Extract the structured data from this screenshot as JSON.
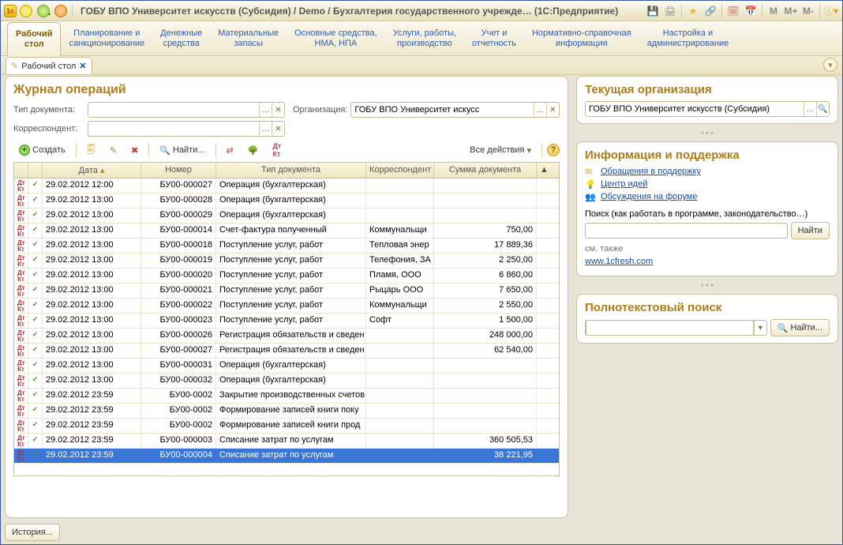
{
  "titlebar": {
    "title": "ГОБУ ВПО Университет искусств (Субсидия) / Demo / Бухгалтерия государственного учрежде… (1С:Предприятие)",
    "m": "M",
    "mplus": "M+",
    "mminus": "M-"
  },
  "nav": {
    "items": [
      {
        "l1": "Рабочий",
        "l2": "стол"
      },
      {
        "l1": "Планирование и",
        "l2": "санкционирование"
      },
      {
        "l1": "Денежные",
        "l2": "средства"
      },
      {
        "l1": "Материальные",
        "l2": "запасы"
      },
      {
        "l1": "Основные средства,",
        "l2": "НМА, НПА"
      },
      {
        "l1": "Услуги, работы,",
        "l2": "производство"
      },
      {
        "l1": "Учет и",
        "l2": "отчетность"
      },
      {
        "l1": "Нормативно-справочная",
        "l2": "информация"
      },
      {
        "l1": "Настройка и",
        "l2": "администрирование"
      }
    ]
  },
  "tabs": {
    "items": [
      {
        "label": "Рабочий стол"
      }
    ]
  },
  "journal": {
    "title": "Журнал операций",
    "doc_type_label": "Тип документа:",
    "org_label": "Организация:",
    "org_value": "ГОБУ ВПО Университет искусс",
    "korr_label": "Корреспондент:",
    "toolbar": {
      "create": "Создать",
      "find": "Найти...",
      "all_actions": "Все действия"
    },
    "columns": {
      "date": "Дата",
      "number": "Номер",
      "doc_type": "Тип документа",
      "korr": "Корреспондент",
      "sum": "Сумма документа"
    },
    "rows": [
      {
        "date": "29.02.2012 12:00",
        "num": "БУ00-000027",
        "type": "Операция (бухгалтерская)",
        "korr": "",
        "sum": ""
      },
      {
        "date": "29.02.2012 13:00",
        "num": "БУ00-000028",
        "type": "Операция (бухгалтерская)",
        "korr": "",
        "sum": ""
      },
      {
        "date": "29.02.2012 13:00",
        "num": "БУ00-000029",
        "type": "Операция (бухгалтерская)",
        "korr": "",
        "sum": ""
      },
      {
        "date": "29.02.2012 13:00",
        "num": "БУ00-000014",
        "type": "Счет-фактура полученный",
        "korr": "Коммунальщи",
        "sum": "750,00"
      },
      {
        "date": "29.02.2012 13:00",
        "num": "БУ00-000018",
        "type": "Поступление услуг, работ",
        "korr": "Тепловая энер",
        "sum": "17 889,36"
      },
      {
        "date": "29.02.2012 13:00",
        "num": "БУ00-000019",
        "type": "Поступление услуг, работ",
        "korr": "Телефония, ЗА",
        "sum": "2 250,00"
      },
      {
        "date": "29.02.2012 13:00",
        "num": "БУ00-000020",
        "type": "Поступление услуг, работ",
        "korr": "Пламя, ООО",
        "sum": "6 860,00"
      },
      {
        "date": "29.02.2012 13:00",
        "num": "БУ00-000021",
        "type": "Поступление услуг, работ",
        "korr": "Рыцарь ООО",
        "sum": "7 650,00"
      },
      {
        "date": "29.02.2012 13:00",
        "num": "БУ00-000022",
        "type": "Поступление услуг, работ",
        "korr": "Коммунальщи",
        "sum": "2 550,00"
      },
      {
        "date": "29.02.2012 13:00",
        "num": "БУ00-000023",
        "type": "Поступление услуг, работ",
        "korr": "Софт",
        "sum": "1 500,00"
      },
      {
        "date": "29.02.2012 13:00",
        "num": "БУ00-000026",
        "type": "Регистрация обязательств и сведен",
        "korr": "",
        "sum": "248 000,00"
      },
      {
        "date": "29.02.2012 13:00",
        "num": "БУ00-000027",
        "type": "Регистрация обязательств и сведен",
        "korr": "",
        "sum": "62 540,00"
      },
      {
        "date": "29.02.2012 13:00",
        "num": "БУ00-000031",
        "type": "Операция (бухгалтерская)",
        "korr": "",
        "sum": ""
      },
      {
        "date": "29.02.2012 13:00",
        "num": "БУ00-000032",
        "type": "Операция (бухгалтерская)",
        "korr": "",
        "sum": ""
      },
      {
        "date": "29.02.2012 23:59",
        "num": "БУ00-0002",
        "type": "Закрытие производственных счетов",
        "korr": "",
        "sum": ""
      },
      {
        "date": "29.02.2012 23:59",
        "num": "БУ00-0002",
        "type": "Формирование записей книги поку",
        "korr": "",
        "sum": ""
      },
      {
        "date": "29.02.2012 23:59",
        "num": "БУ00-0002",
        "type": "Формирование записей книги прод",
        "korr": "",
        "sum": ""
      },
      {
        "date": "29.02.2012 23:59",
        "num": "БУ00-000003",
        "type": "Списание затрат по услугам",
        "korr": "",
        "sum": "360 505,53"
      },
      {
        "date": "29.02.2012 23:59",
        "num": "БУ00-000004",
        "type": "Списание затрат по услугам",
        "korr": "",
        "sum": "38 221,95",
        "selected": true
      }
    ]
  },
  "right": {
    "org_title": "Текущая организация",
    "org_value": "ГОБУ ВПО Университет искусств (Субсидия)",
    "info_title": "Информация и поддержка",
    "link_support": "Обращения в поддержку",
    "link_ideas": "Центр идей",
    "link_forum": "Обсуждения на форуме",
    "search_label": "Поиск (как работать в программе, законодательство…)",
    "find_btn": "Найти",
    "see_also": "см. также",
    "link_fresh": "www.1cfresh.com",
    "ft_title": "Полнотекстовый поиск",
    "ft_find": "Найти..."
  },
  "bottom": {
    "history": "История..."
  }
}
